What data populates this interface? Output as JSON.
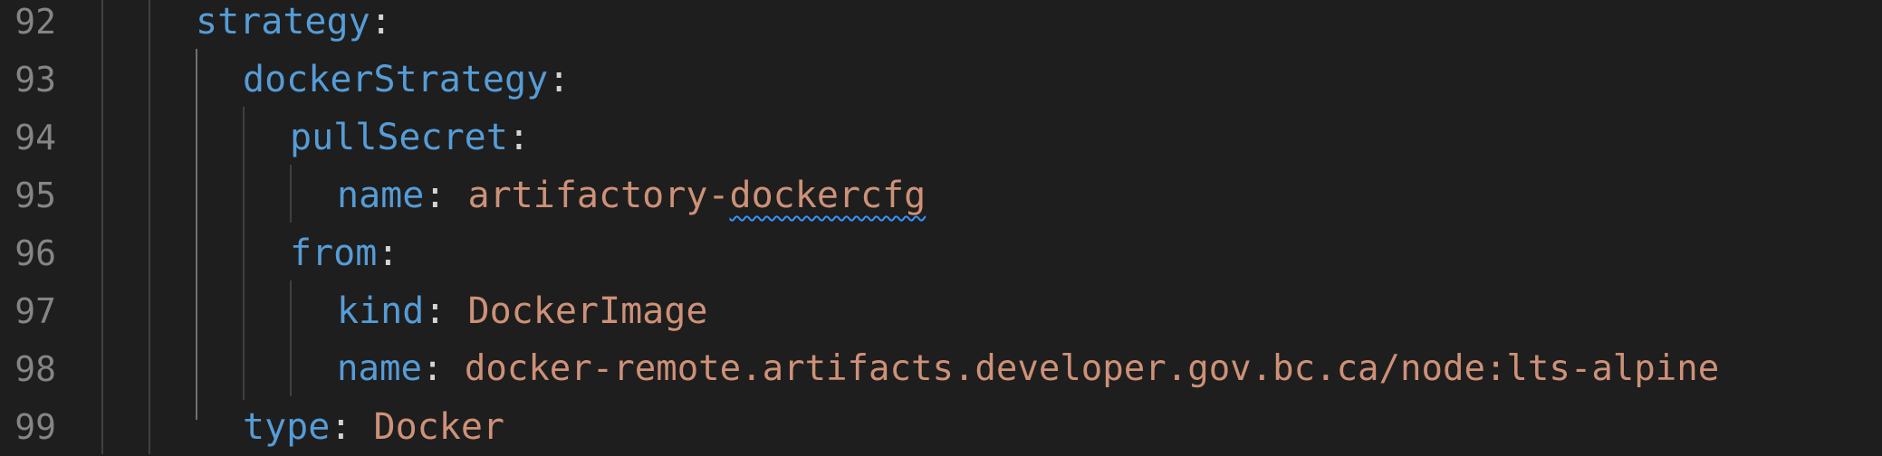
{
  "colors": {
    "background": "#1e1e1e",
    "line_number": "#858585",
    "yaml_key": "#569cd6",
    "yaml_string": "#ce9178",
    "punctuation": "#d4d4d4",
    "indent_guide": "#404040",
    "squiggle": "#3794ff"
  },
  "lines": [
    {
      "number": "92",
      "key": "strategy",
      "sep": ":",
      "value": ""
    },
    {
      "number": "93",
      "key": "dockerStrategy",
      "sep": ":",
      "value": ""
    },
    {
      "number": "94",
      "key": "pullSecret",
      "sep": ":",
      "value": ""
    },
    {
      "number": "95",
      "key": "name",
      "sep": ": ",
      "value_prefix": "artifactory-",
      "value_flagged": "dockercfg"
    },
    {
      "number": "96",
      "key": "from",
      "sep": ":",
      "value": ""
    },
    {
      "number": "97",
      "key": "kind",
      "sep": ": ",
      "value": "DockerImage"
    },
    {
      "number": "98",
      "key": "name",
      "sep": ": ",
      "value": "docker-remote.artifacts.developer.gov.bc.ca/node:lts-alpine"
    },
    {
      "number": "99",
      "key": "type",
      "sep": ": ",
      "value": "Docker"
    }
  ]
}
